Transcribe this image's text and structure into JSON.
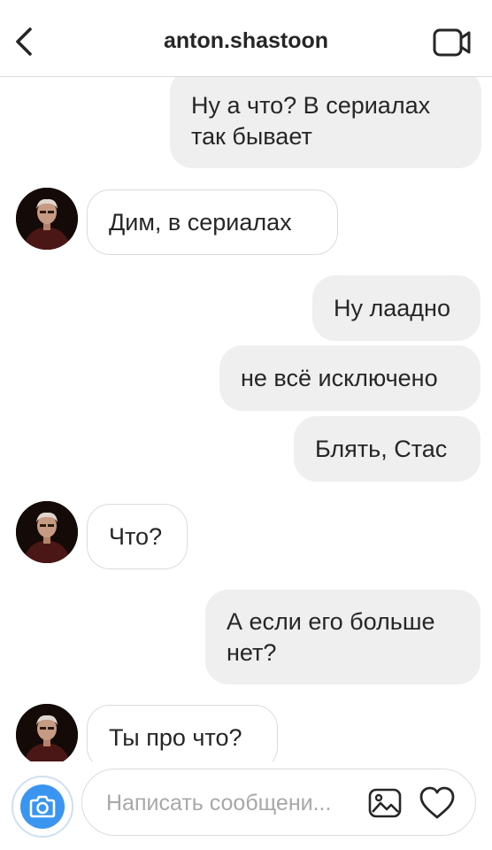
{
  "header": {
    "username": "anton.shastoon",
    "back_icon": "chevron-left-icon",
    "video_icon": "video-camera-icon"
  },
  "messages": [
    {
      "direction": "outgoing",
      "text": "Ну а что? В сериалах так бывает"
    },
    {
      "direction": "incoming",
      "text": "Дим, в сериалах"
    },
    {
      "direction": "outgoing",
      "text": "Ну лаадно"
    },
    {
      "direction": "outgoing",
      "text": "не всё исключено"
    },
    {
      "direction": "outgoing",
      "text": "Блять, Стас"
    },
    {
      "direction": "incoming",
      "text": "Что?"
    },
    {
      "direction": "outgoing",
      "text": "А если его больше нет?"
    },
    {
      "direction": "incoming",
      "text": "Ты про что?"
    }
  ],
  "composer": {
    "placeholder": "Написать сообщени...",
    "camera_icon": "camera-icon",
    "gallery_icon": "image-icon",
    "like_icon": "heart-icon"
  },
  "colors": {
    "accent": "#3a95f0",
    "outgoing_bubble": "#efefef",
    "incoming_border": "#dbdbdb",
    "text": "#262626"
  }
}
